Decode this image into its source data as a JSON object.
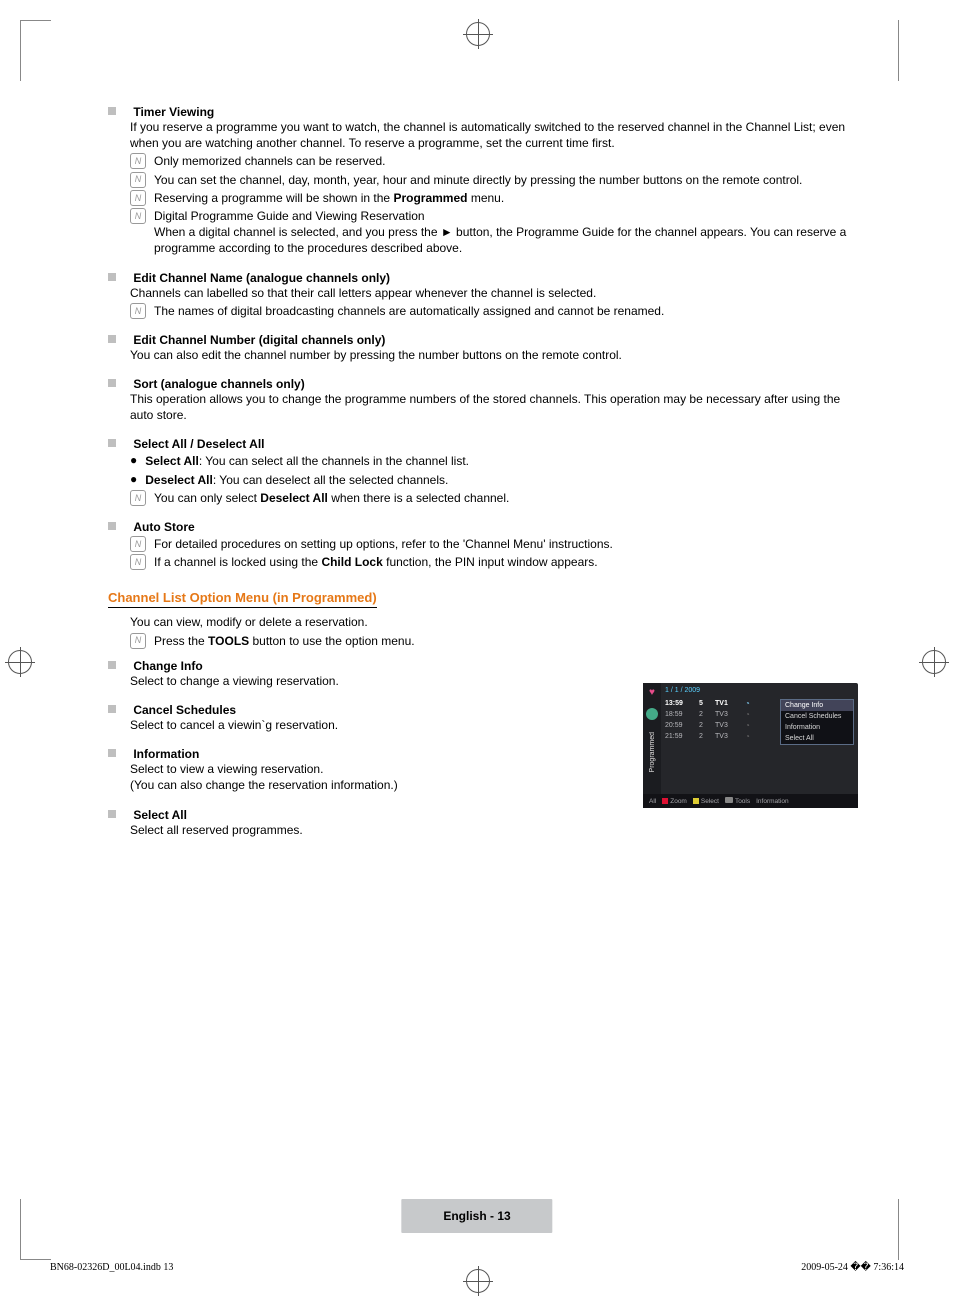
{
  "sections": {
    "timer_viewing": {
      "title": "Timer Viewing",
      "intro": "If you reserve a programme you want to watch, the channel is automatically switched to the reserved channel in the Channel List; even when you are watching another channel. To reserve a programme, set the current time first.",
      "n1": "Only memorized channels can be reserved.",
      "n2": "You can set the channel, day, month, year, hour and minute directly by pressing the number buttons on the remote control.",
      "n3_a": "Reserving a programme will be shown in the ",
      "n3_b": "Programmed",
      "n3_c": " menu.",
      "n4_line1": "Digital Programme Guide and Viewing Reservation",
      "n4_line2": "When a digital channel is selected, and you press the ► button, the Programme Guide for the channel appears. You can reserve a programme according to the procedures described above."
    },
    "edit_name": {
      "title": "Edit Channel Name (analogue channels only)",
      "body": "Channels can labelled so that their call letters appear whenever the channel is selected.",
      "n1": "The names of digital broadcasting channels are automatically assigned and cannot be renamed."
    },
    "edit_num": {
      "title": "Edit Channel Number (digital channels only)",
      "body": "You can also edit the channel number by pressing the number buttons on the remote control."
    },
    "sort": {
      "title": "Sort (analogue channels only)",
      "body": "This operation allows you to change the programme numbers of the stored channels. This operation may be necessary after using the auto store."
    },
    "select_all": {
      "title": "Select All / Deselect All",
      "b1_t": "Select All",
      "b1_r": ": You can select all the channels in the channel list.",
      "b2_t": "Deselect All",
      "b2_r": ": You can deselect all the selected channels.",
      "n1_a": "You can only select ",
      "n1_b": "Deselect All",
      "n1_c": " when there is a selected channel."
    },
    "auto_store": {
      "title": "Auto Store",
      "n1": "For detailed procedures on setting up options, refer to the 'Channel Menu' instructions.",
      "n2_a": "If a channel is locked using the ",
      "n2_b": "Child Lock",
      "n2_c": " function, the PIN input window appears."
    }
  },
  "option_menu": {
    "heading": "Channel List Option Menu (in Programmed)",
    "intro": "You can view, modify or delete a reservation.",
    "n1_a": "Press the ",
    "n1_b": "TOOLS",
    "n1_c": " button to use the option menu.",
    "change_info": {
      "title": "Change Info",
      "body": "Select to change a viewing reservation."
    },
    "cancel": {
      "title": "Cancel Schedules",
      "body": "Select to cancel a viewin`g reservation."
    },
    "information": {
      "title": "Information",
      "body1": "Select to view a viewing reservation.",
      "body2": "(You can also change the reservation information.)"
    },
    "select_all": {
      "title": "Select All",
      "body": "Select all reserved programmes."
    }
  },
  "screenshot": {
    "sidebar_label": "Programmed",
    "date": "1 / 1 / 2009",
    "rows": [
      {
        "time": "13:59",
        "ch": "5",
        "name": "TV1",
        "hi": true
      },
      {
        "time": "18:59",
        "ch": "2",
        "name": "TV3",
        "hi": false
      },
      {
        "time": "20:59",
        "ch": "2",
        "name": "TV3",
        "hi": false
      },
      {
        "time": "21:59",
        "ch": "2",
        "name": "TV3",
        "hi": false
      }
    ],
    "menu": [
      "Change Info",
      "Cancel Schedules",
      "Information",
      "Select All"
    ],
    "bottom": {
      "all": "All",
      "zoom": "Zoom",
      "select": "Select",
      "tools": "Tools",
      "info": "Information"
    }
  },
  "page_number": "English - 13",
  "footer": {
    "left": "BN68-02326D_00L04.indb   13",
    "right": "2009-05-24   �� 7:36:14"
  }
}
